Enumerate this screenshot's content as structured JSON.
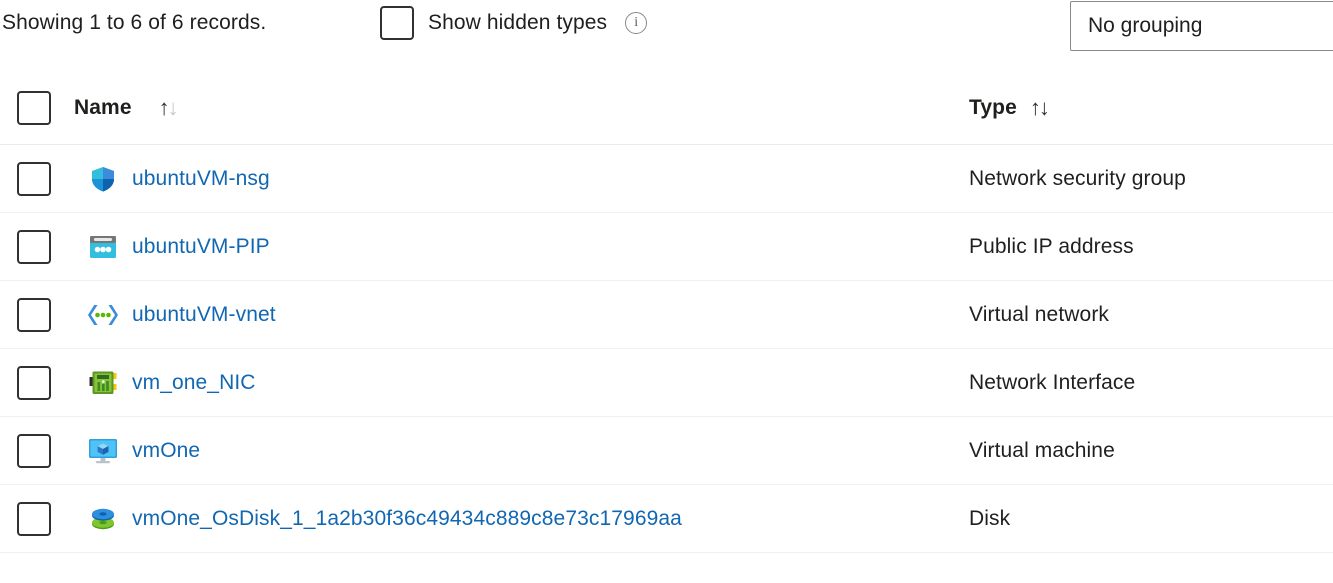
{
  "toolbar": {
    "records_label": "Showing 1 to 6 of 6 records.",
    "show_hidden_types_label": "Show hidden types",
    "info_glyph": "i",
    "grouping_value": "No grouping"
  },
  "table": {
    "columns": [
      {
        "key": "name",
        "label": "Name",
        "sort_up": "↑",
        "sort_down": "↓",
        "sort_state": "ascending"
      },
      {
        "key": "type",
        "label": "Type",
        "sort_up": "↑",
        "sort_down": "↓",
        "sort_state": "none"
      }
    ],
    "rows": [
      {
        "name": "ubuntuVM-nsg",
        "type": "Network security group",
        "icon": "network-security-group-icon"
      },
      {
        "name": "ubuntuVM-PIP",
        "type": "Public IP address",
        "icon": "public-ip-address-icon"
      },
      {
        "name": "ubuntuVM-vnet",
        "type": "Virtual network",
        "icon": "virtual-network-icon"
      },
      {
        "name": "vm_one_NIC",
        "type": "Network Interface",
        "icon": "network-interface-icon"
      },
      {
        "name": "vmOne",
        "type": "Virtual machine",
        "icon": "virtual-machine-icon"
      },
      {
        "name": "vmOne_OsDisk_1_1a2b30f36c49434c889c8e73c17969aa",
        "type": "Disk",
        "icon": "disk-icon"
      }
    ]
  },
  "colors": {
    "link": "#1267b2",
    "text": "#201f1e",
    "border": "#8a8886",
    "row_divider": "#f0f0f0"
  }
}
